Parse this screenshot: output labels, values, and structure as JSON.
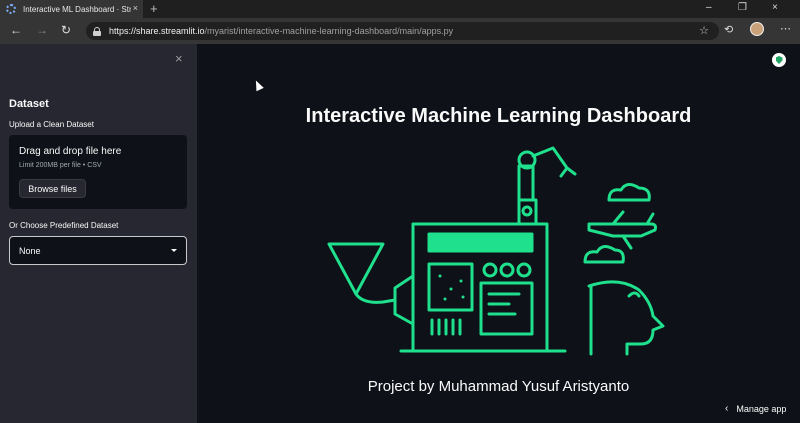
{
  "browser": {
    "tab_title": "Interactive ML Dashboard · Streamlit",
    "tab_close": "×",
    "new_tab": "+",
    "window_controls": [
      "–",
      "❐",
      "×"
    ],
    "url_host": "https://share.streamlit.io",
    "url_path": "/myarist/interactive-machine-learning-dashboard/main/apps.py"
  },
  "sidebar": {
    "close_icon": "×",
    "heading": "Dataset",
    "upload_label": "Upload a Clean Dataset",
    "uploader": {
      "title": "Drag and drop file here",
      "limit": "Limit 200MB per file • CSV",
      "button": "Browse files"
    },
    "predefined_label": "Or Choose Predefined Dataset",
    "select_value": "None"
  },
  "main": {
    "title": "Interactive Machine Learning Dashboard",
    "credit": "Project by Muhammad Yusuf Aristyanto",
    "manage_app": "Manage app"
  },
  "colors": {
    "accent": "#1fe08c",
    "sidebar_bg": "#262730",
    "main_bg": "#0e1117"
  }
}
